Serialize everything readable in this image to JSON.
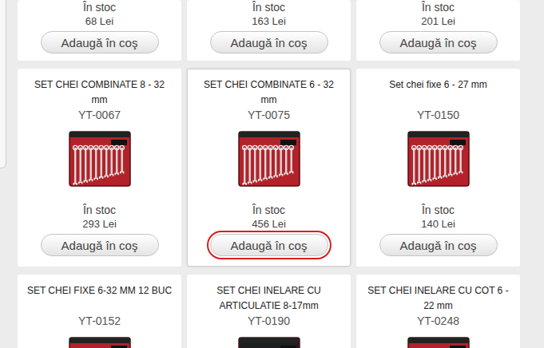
{
  "rows": [
    {
      "cut": true,
      "cards": [
        {
          "stock": "În stoc",
          "price": "68 Lei",
          "button": {
            "label": "Adaugă în coş",
            "highlighted": false
          },
          "hovered": false
        },
        {
          "stock": "În stoc",
          "price": "163 Lei",
          "button": {
            "label": "Adaugă în coş",
            "highlighted": false
          },
          "hovered": false
        },
        {
          "stock": "În stoc",
          "price": "201 Lei",
          "button": {
            "label": "Adaugă în coş",
            "highlighted": false
          },
          "hovered": false
        }
      ]
    },
    {
      "cut": false,
      "cards": [
        {
          "title": "SET CHEI COMBINATE 8 - 32 mm",
          "code": "YT-0067",
          "color": "#b3222a",
          "stock": "În stoc",
          "price": "293 Lei",
          "button": {
            "label": "Adaugă în coş",
            "highlighted": false
          },
          "hovered": false
        },
        {
          "title": "SET CHEI COMBINATE 6 - 32 mm",
          "code": "YT-0075",
          "color": "#b3222a",
          "stock": "În stoc",
          "price": "456 Lei",
          "button": {
            "label": "Adaugă în coş",
            "highlighted": true
          },
          "hovered": true
        },
        {
          "title": "Set chei fixe 6 - 27 mm",
          "code": "YT-0150",
          "color": "#b3222a",
          "stock": "În stoc",
          "price": "140 Lei",
          "button": {
            "label": "Adaugă în coş",
            "highlighted": false
          },
          "hovered": false
        }
      ]
    },
    {
      "cut": false,
      "cards": [
        {
          "title": "SET CHEI FIXE 6-32 MM 12 BUC",
          "code": "YT-0152",
          "color": "#b3222a",
          "hovered": false
        },
        {
          "title": "SET CHEI INELARE CU ARTICULATIE 8-17mm",
          "code": "YT-0190",
          "color": "#1e1e1e",
          "hovered": false
        },
        {
          "title": "SET CHEI INELARE CU COT 6 - 22 mm",
          "code": "YT-0248",
          "color": "#b3222a",
          "hovered": false
        }
      ]
    }
  ]
}
